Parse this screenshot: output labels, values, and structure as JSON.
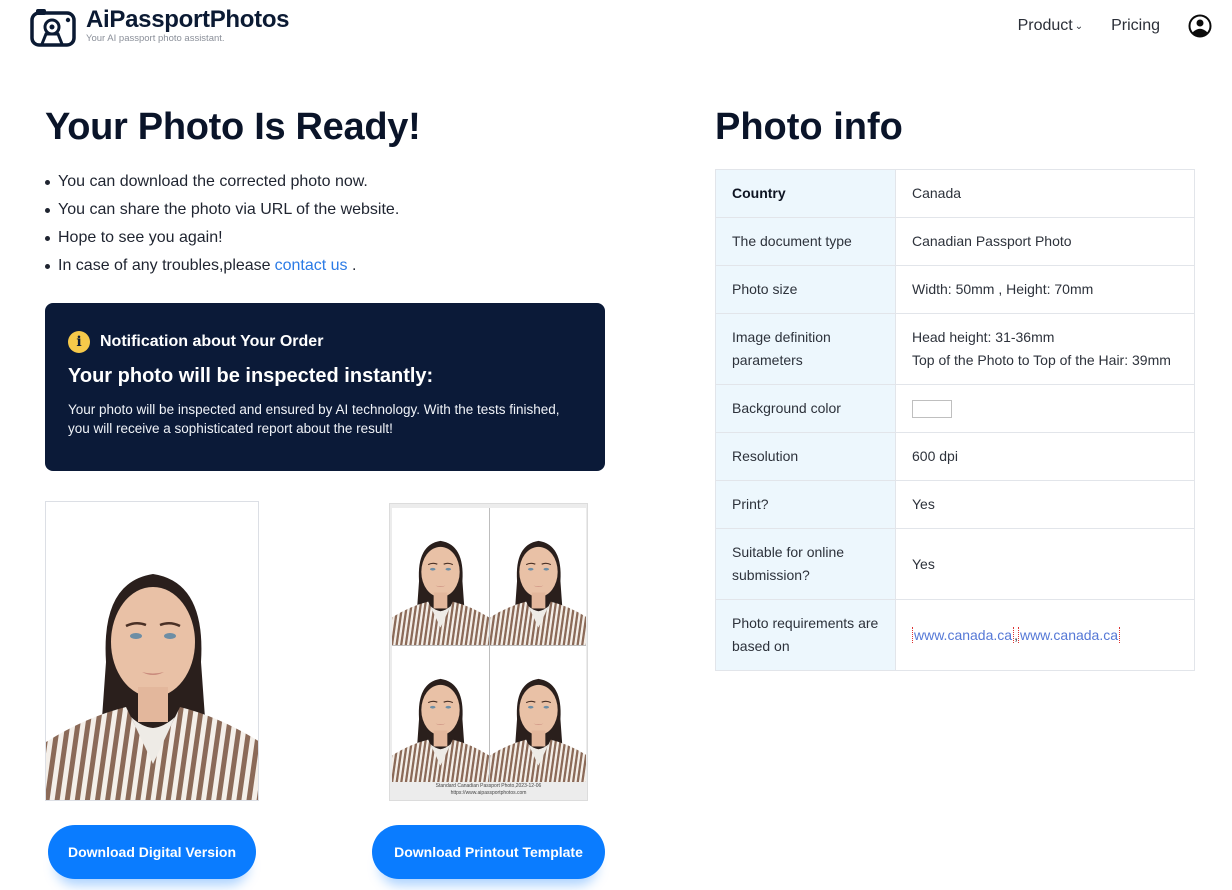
{
  "header": {
    "brand": "AiPassportPhotos",
    "tagline": "Your AI passport photo assistant.",
    "nav": [
      {
        "label": "Product",
        "has_dropdown": true
      },
      {
        "label": "Pricing",
        "has_dropdown": false
      }
    ],
    "user_icon": "user-circle-icon"
  },
  "main": {
    "title": "Your Photo Is Ready!",
    "bullets": [
      "You can download the corrected photo now.",
      "You can share the photo via URL of the website.",
      "Hope to see you again!",
      "In case of any troubles,please"
    ],
    "contact_link": "contact us",
    "contact_suffix": ".",
    "notice": {
      "icon": "info-icon",
      "heading": "Notification about Your Order",
      "title": "Your photo will be inspected instantly:",
      "body": "Your photo will be inspected and ensured by AI technology. With the tests finished, you will receive a sophisticated report about the result!"
    },
    "sheet_caption_line1": "Standard Canadian Passport Photo,2023-12-06",
    "sheet_caption_line2": "https://www.aipassportphotos.com",
    "buttons": {
      "digital": "Download Digital Version",
      "print": "Download Printout Template"
    },
    "colors": {
      "accent": "#0a7cff",
      "notice_bg": "#0b1a38",
      "info_icon": "#f6c94a",
      "link": "#2b7be6"
    }
  },
  "info": {
    "title": "Photo info",
    "rows": [
      {
        "key": "Country",
        "value": "Canada"
      },
      {
        "key": "The document type",
        "value": "Canadian Passport Photo"
      },
      {
        "key": "Photo size",
        "value": "Width: 50mm , Height: 70mm"
      },
      {
        "key": "Image definition parameters",
        "value_line1": "Head height: 31-36mm",
        "value_line2": "Top of the Photo to Top of the Hair: 39mm"
      },
      {
        "key": "Background color",
        "value_color": "#ffffff"
      },
      {
        "key": "Resolution",
        "value": "600 dpi"
      },
      {
        "key": "Print?",
        "value": "Yes"
      },
      {
        "key": "Suitable for online submission?",
        "value": "Yes"
      },
      {
        "key": "Photo requirements are based on",
        "links": [
          "www.canada.ca",
          "www.canada.ca"
        ],
        "separator": ","
      }
    ]
  }
}
